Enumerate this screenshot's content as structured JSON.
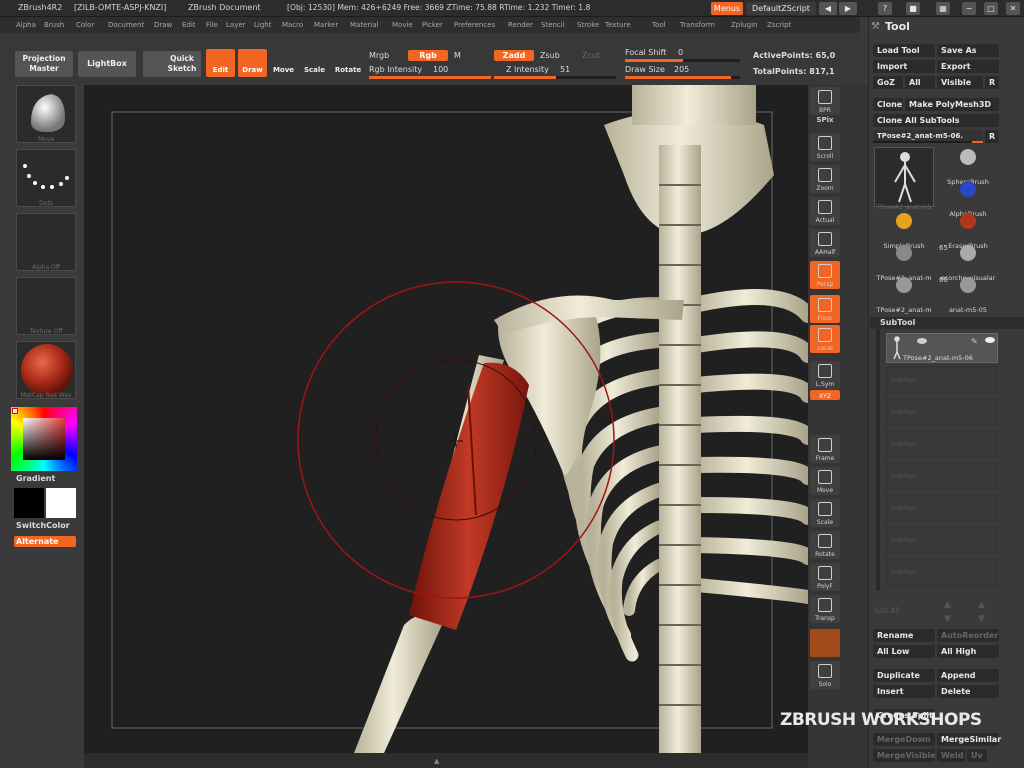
{
  "titlebar": {
    "app": "ZBrush4R2",
    "serial": "[ZILB-OMTE-ASPJ-KNZI]",
    "document": "ZBrush Document",
    "stats": "[Obj: 12530]  Mem: 426+6249  Free: 3669  ZTime: 75.88  RTime: 1.232  Timer: 1.8",
    "menus_btn": "Menus",
    "script_btn": "DefaultZScript"
  },
  "menubar": [
    "Alpha",
    "Brush",
    "Color",
    "Document",
    "Draw",
    "Edit",
    "File",
    "Layer",
    "Light",
    "Macro",
    "Marker",
    "Material",
    "Movie",
    "Picker",
    "Preferences",
    "Render",
    "Stencil",
    "Stroke",
    "Texture",
    "Tool",
    "Transform",
    "Zplugin",
    "Zscript"
  ],
  "shelf": {
    "projection_master": "Projection Master",
    "lightbox": "LightBox",
    "quick_sketch": "Quick Sketch",
    "edit": "Edit",
    "draw": "Draw",
    "move": "Move",
    "scale": "Scale",
    "rotate": "Rotate",
    "mrgb": "Mrgb",
    "rgb": "Rgb",
    "m": "M",
    "rgb_intensity_label": "Rgb Intensity",
    "rgb_intensity_value": "100",
    "zadd": "Zadd",
    "zsub": "Zsub",
    "zcut": "Zcut",
    "z_intensity_label": "Z Intensity",
    "z_intensity_value": "51",
    "focal_shift_label": "Focal Shift",
    "focal_shift_value": "0",
    "draw_size_label": "Draw Size",
    "draw_size_value": "205",
    "active_points": "ActivePoints: 65,0",
    "total_points": "TotalPoints: 817,1"
  },
  "left": {
    "brush_cap": "Move",
    "stroke_cap": "Dots",
    "alpha_cap": "Alpha Off",
    "texture_cap": "Texture Off",
    "material_cap": "MatCap Red Wax",
    "gradient": "Gradient",
    "switchcolor": "SwitchColor",
    "alternate": "Alternate"
  },
  "right_shelf": [
    {
      "name": "bpr-button",
      "label": "BPR"
    },
    {
      "name": "spix-label",
      "label": "SPix"
    },
    {
      "name": "scroll-button",
      "label": "Scroll"
    },
    {
      "name": "zoom-button",
      "label": "Zoom"
    },
    {
      "name": "actual-button",
      "label": "Actual"
    },
    {
      "name": "aahalf-button",
      "label": "AAHalf"
    },
    {
      "name": "persp-button",
      "label": "Persp"
    },
    {
      "name": "floor-button",
      "label": "Floor"
    },
    {
      "name": "local-button",
      "label": "Local"
    },
    {
      "name": "lsym-button",
      "label": "L.Sym"
    },
    {
      "name": "xyz-button",
      "label": "XYZ"
    },
    {
      "name": "frame-button",
      "label": "Frame"
    },
    {
      "name": "move-view-button",
      "label": "Move"
    },
    {
      "name": "scale-view-button",
      "label": "Scale"
    },
    {
      "name": "rotate-view-button",
      "label": "Rotate"
    },
    {
      "name": "polyf-button",
      "label": "PolyF"
    },
    {
      "name": "transp-button",
      "label": "Transp"
    },
    {
      "name": "solo-button",
      "label": "Solo"
    }
  ],
  "tool": {
    "title": "Tool",
    "load_tool": "Load Tool",
    "save_as": "Save As",
    "import": "Import",
    "export": "Export",
    "goz": "GoZ",
    "all": "All",
    "visible": "Visible",
    "r": "R",
    "clone": "Clone",
    "make_polymesh": "Make PolyMesh3D",
    "clone_all": "Clone  All  SubTools",
    "current_tool": "TPose#2_anat-m5-06.",
    "tools": [
      {
        "label": "TPose#2_anat-m5"
      },
      {
        "label": "SphereBrush"
      },
      {
        "label": "AlphaBrush"
      },
      {
        "label": "SimpleBrush"
      },
      {
        "label": "EraserBrush"
      },
      {
        "label": "TPose#1_anat-m"
      },
      {
        "label": "ecorche_visualar"
      },
      {
        "label": "TPose#2_anat-m"
      },
      {
        "label": "anat-m5-05"
      }
    ],
    "count_a": "65",
    "count_b": "60",
    "subtool_header": "SubTool",
    "subtool_active": "TPose#2_anat-m5-06",
    "subtool_empty": [
      "SubTool",
      "SubTool",
      "SubTool",
      "SubTool",
      "SubTool",
      "SubTool",
      "SubTool"
    ],
    "list_all": "List  All",
    "rename": "Rename",
    "autoreorder": "AutoReorder",
    "all_low": "All Low",
    "all_high": "All High",
    "duplicate": "Duplicate",
    "append": "Append",
    "insert": "Insert",
    "delete": "Delete",
    "groups_split": "Groups Split",
    "merge_down": "MergeDown",
    "merge_similar": "MergeSimilar",
    "merge_visible": "MergeVisible",
    "weld": "Weld",
    "uv": "Uv"
  },
  "watermark": "ZBRUSH WORKSHOPS",
  "colors": {
    "accent": "#f26522",
    "panel": "#3a3a3a",
    "canvas": "#202020",
    "bone": "#e4dfc8",
    "muscle": "#b0271b"
  }
}
